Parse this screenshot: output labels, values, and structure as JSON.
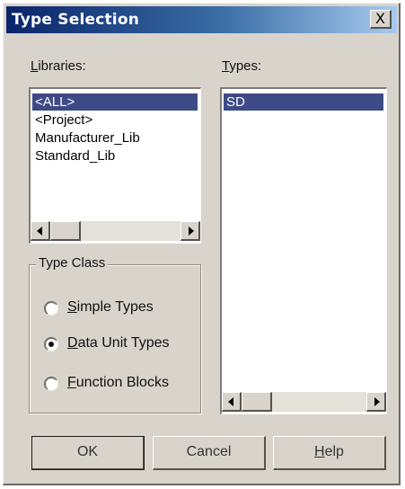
{
  "window": {
    "title": "Type Selection",
    "close_glyph": "X"
  },
  "libraries": {
    "label_prefix": "",
    "label_accel": "L",
    "label_rest": "ibraries:",
    "items": [
      "<ALL>",
      "<Project>",
      "Manufacturer_Lib",
      "Standard_Lib"
    ],
    "selected_index": 0
  },
  "types": {
    "label_accel": "T",
    "label_rest": "ypes:",
    "items": [
      "SD"
    ],
    "selected_index": 0
  },
  "type_class": {
    "legend": "Type Class",
    "options": [
      {
        "accel": "S",
        "rest": "imple Types",
        "checked": false
      },
      {
        "accel": "D",
        "rest": "ata Unit Types",
        "checked": true
      },
      {
        "accel": "F",
        "rest": "unction Blocks",
        "checked": false
      }
    ]
  },
  "buttons": {
    "ok": "OK",
    "cancel": "Cancel",
    "help_accel": "H",
    "help_rest": "elp"
  },
  "icons": {
    "close": "close-icon",
    "scroll_left": "arrow-left-icon",
    "scroll_right": "arrow-right-icon"
  }
}
